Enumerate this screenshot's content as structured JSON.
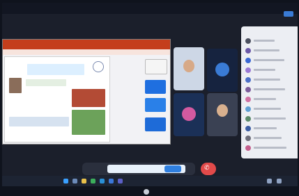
{
  "window": {
    "title": ""
  },
  "participants_panel": {
    "title": "",
    "rows": 12
  },
  "colors": {
    "accent_blue": "#3a7bd5",
    "leave_red": "#e24a4a",
    "ppt_red": "#c43e1c"
  },
  "icons": [
    "search-icon",
    "start-icon",
    "chrome-icon",
    "edge-icon",
    "explorer-icon",
    "mail-icon",
    "teams-icon",
    "monitor-logo-icon"
  ]
}
